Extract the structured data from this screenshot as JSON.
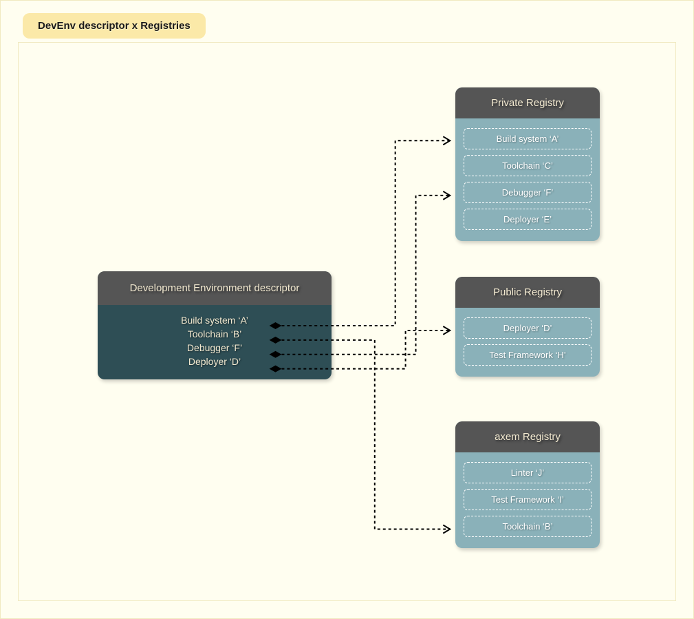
{
  "title": "DevEnv descriptor x Registries",
  "descriptor": {
    "header": "Development Environment descriptor",
    "items": [
      "Build system ‘A’",
      "Toolchain ‘B’",
      "Debugger ‘F’",
      "Deployer ‘D’"
    ]
  },
  "registries": [
    {
      "header": "Private Registry",
      "items": [
        "Build system ‘A’",
        "Toolchain ‘C’",
        "Debugger ‘F’",
        "Deployer ‘E’"
      ]
    },
    {
      "header": "Public Registry",
      "items": [
        "Deployer ‘D’",
        "Test Framework ‘H’"
      ]
    },
    {
      "header": "axem Registry",
      "items": [
        "Linter ‘J’",
        "Test Framework ‘I’",
        "Toolchain ‘B’"
      ]
    }
  ],
  "connections": [
    {
      "from": "Build system ‘A’",
      "to_registry": "Private Registry",
      "to_item": "Build system ‘A’"
    },
    {
      "from": "Toolchain ‘B’",
      "to_registry": "axem Registry",
      "to_item": "Toolchain ‘B’"
    },
    {
      "from": "Debugger ‘F’",
      "to_registry": "Private Registry",
      "to_item": "Debugger ‘F’"
    },
    {
      "from": "Deployer ‘D’",
      "to_registry": "Public Registry",
      "to_item": "Deployer ‘D’"
    }
  ]
}
